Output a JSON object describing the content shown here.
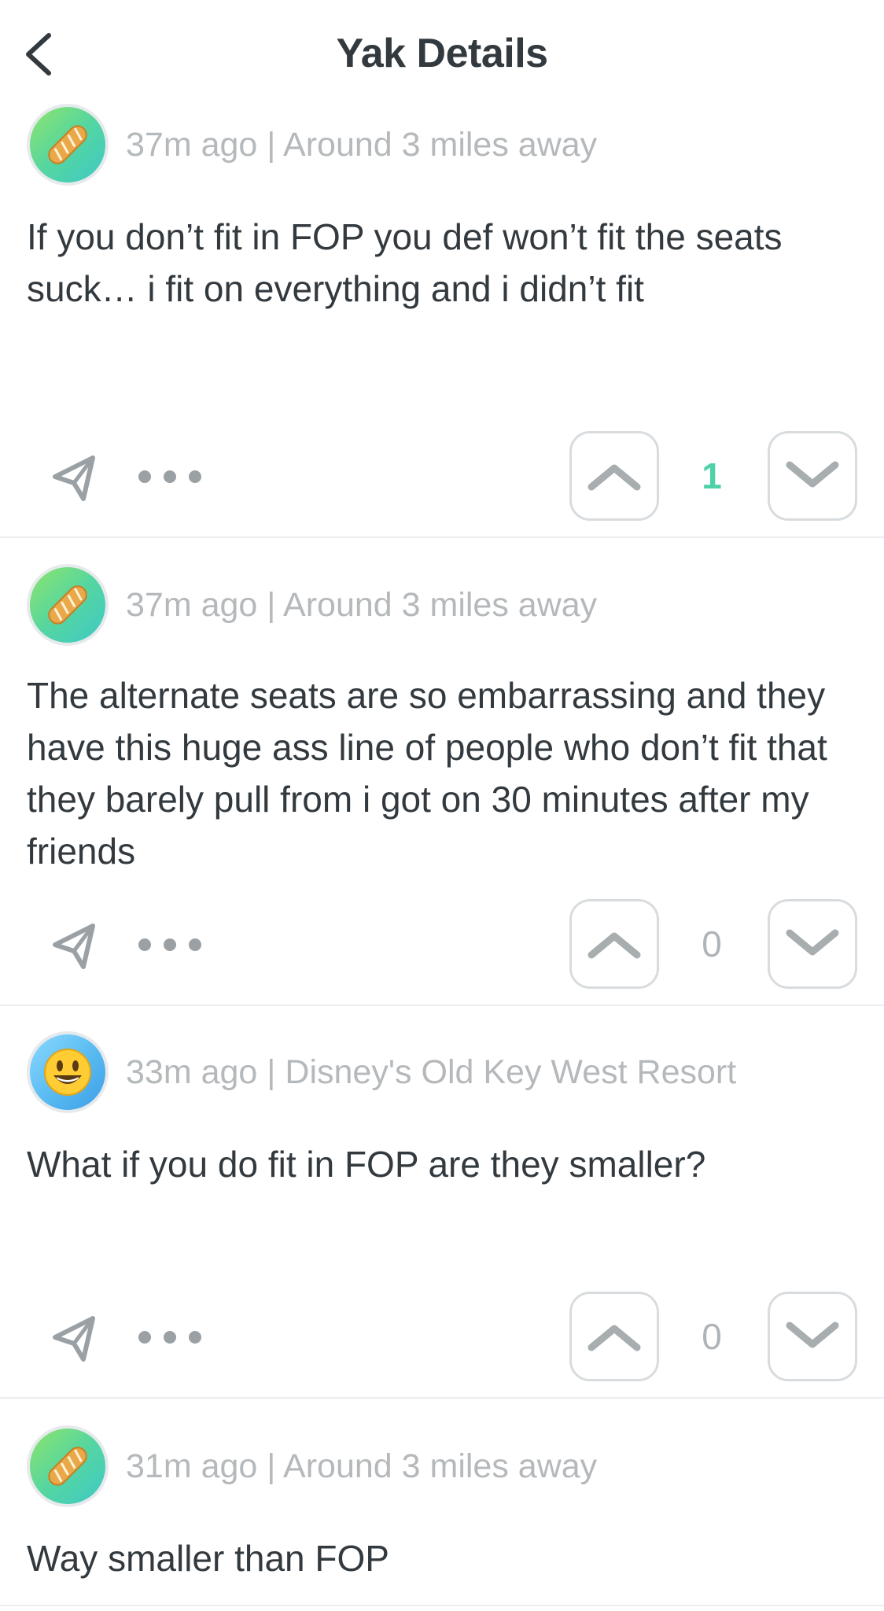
{
  "header": {
    "title": "Yak Details"
  },
  "icons": {
    "back": "chevron-left-icon",
    "share": "paper-plane-icon",
    "more": "more-dots-icon",
    "upvote": "chevron-up-icon",
    "downvote": "chevron-down-icon",
    "avatar_bread": "baguette-emoji",
    "avatar_smile": "smiley-emoji"
  },
  "colors": {
    "positive_score": "#4fd1a8",
    "meta_text": "#b5b9bc",
    "body_text": "#333a3f"
  },
  "posts": [
    {
      "meta": "37m ago | Around 3 miles away",
      "body": "If you don’t fit in FOP you def won’t fit the seats suck… i fit on everything and i didn’t fit",
      "score": "1",
      "avatar": "baguette"
    },
    {
      "meta": "37m ago | Around 3 miles away",
      "body": "The alternate seats are so embarrassing and they have this huge ass line of people who don’t fit that they barely pull from i got on 30 minutes after my friends",
      "score": "0",
      "avatar": "baguette"
    },
    {
      "meta": "33m ago | Disney's Old Key West Resort",
      "body": "What if you do fit in FOP are they smaller?",
      "score": "0",
      "avatar": "smiley"
    },
    {
      "meta": "31m ago | Around 3 miles away",
      "body": "Way smaller than FOP",
      "avatar": "baguette"
    }
  ]
}
